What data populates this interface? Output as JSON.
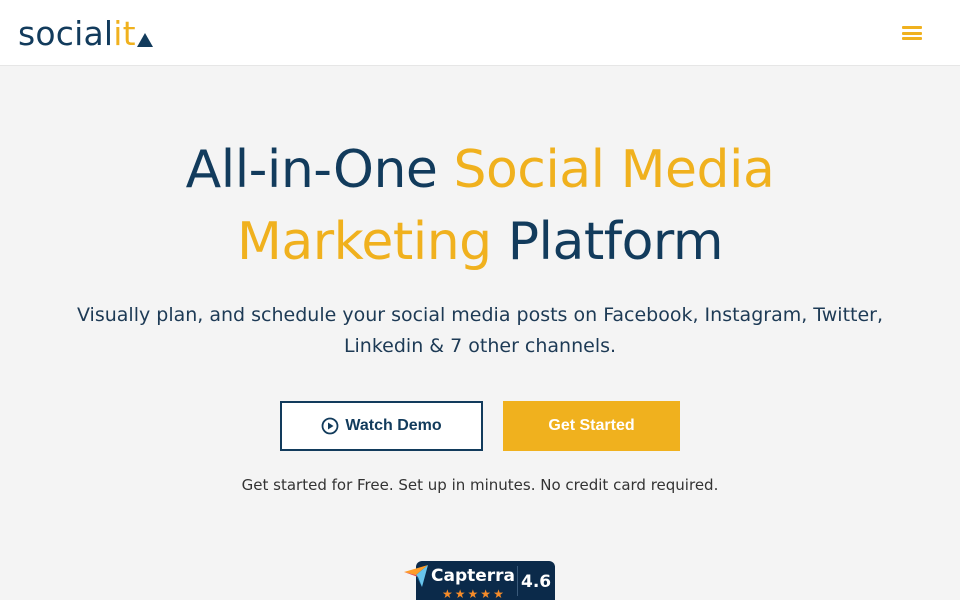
{
  "header": {
    "logo": {
      "main": "social",
      "accent": "it"
    },
    "menu_icon": "hamburger-menu-icon"
  },
  "hero": {
    "title_part1": "All-in-One ",
    "title_part2": "Social Media",
    "title_part3": "Marketing",
    "title_part4": " Platform",
    "subtitle": "Visually plan, and schedule your social media posts on Facebook, Instagram, Twitter, Linkedin & 7 other channels.",
    "watch_demo_label": "Watch Demo",
    "get_started_label": "Get Started",
    "note": "Get started for Free. Set up in minutes. No credit card required."
  },
  "badge": {
    "name": "Capterra",
    "score": "4.6",
    "stars": 4.5
  },
  "colors": {
    "brand_navy": "#123b5c",
    "brand_yellow": "#f0b11e",
    "background": "#f4f4f4"
  }
}
